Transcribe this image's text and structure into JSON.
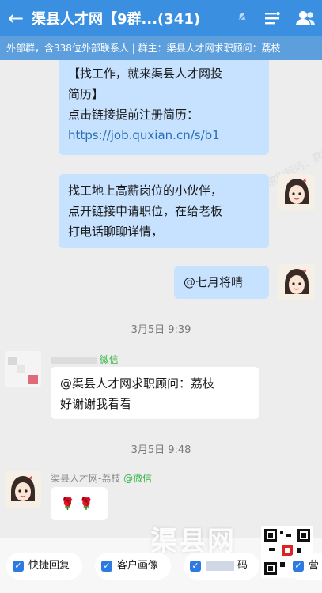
{
  "header": {
    "title": "渠县人才网【9群...(341)",
    "mute_icon": "mute-bell-icon",
    "menu_icon": "menu-icon",
    "group_icon": "group-members-icon"
  },
  "subbar": {
    "text": "外部群，含338位外部联系人 | 群主：渠县人才网求职顾问：荔枝"
  },
  "messages": {
    "m1": {
      "line1": "【找工作，就来渠县人才网投",
      "line2": "简历】",
      "line3": "点击链接提前注册简历：",
      "link": "https://job.quxian.cn/s/b1"
    },
    "m2": {
      "line1": "找工地上高薪岗位的小伙伴，",
      "line2": "点开链接申请职位，在给老板",
      "line3": "打电话聊聊详情，"
    },
    "m3": {
      "text": "@七月将晴"
    },
    "t1": "3月5日  9:39",
    "m4": {
      "sender_wx": "微信",
      "line1": "@渠县人才网求职顾问：荔枝",
      "line2": "好谢谢我看看"
    },
    "t2": "3月5日  9:48",
    "m5": {
      "sender": "渠县人才网-荔枝",
      "sender_wx": "@微信",
      "text": "🌹 🌹"
    }
  },
  "watermark": "渠县人才网求职顾问：荔枝",
  "footer": {
    "quick_reply": "快捷回复",
    "customer_profile": "客户画像",
    "code": "码",
    "extra": "营",
    "brand": "渠县网"
  }
}
